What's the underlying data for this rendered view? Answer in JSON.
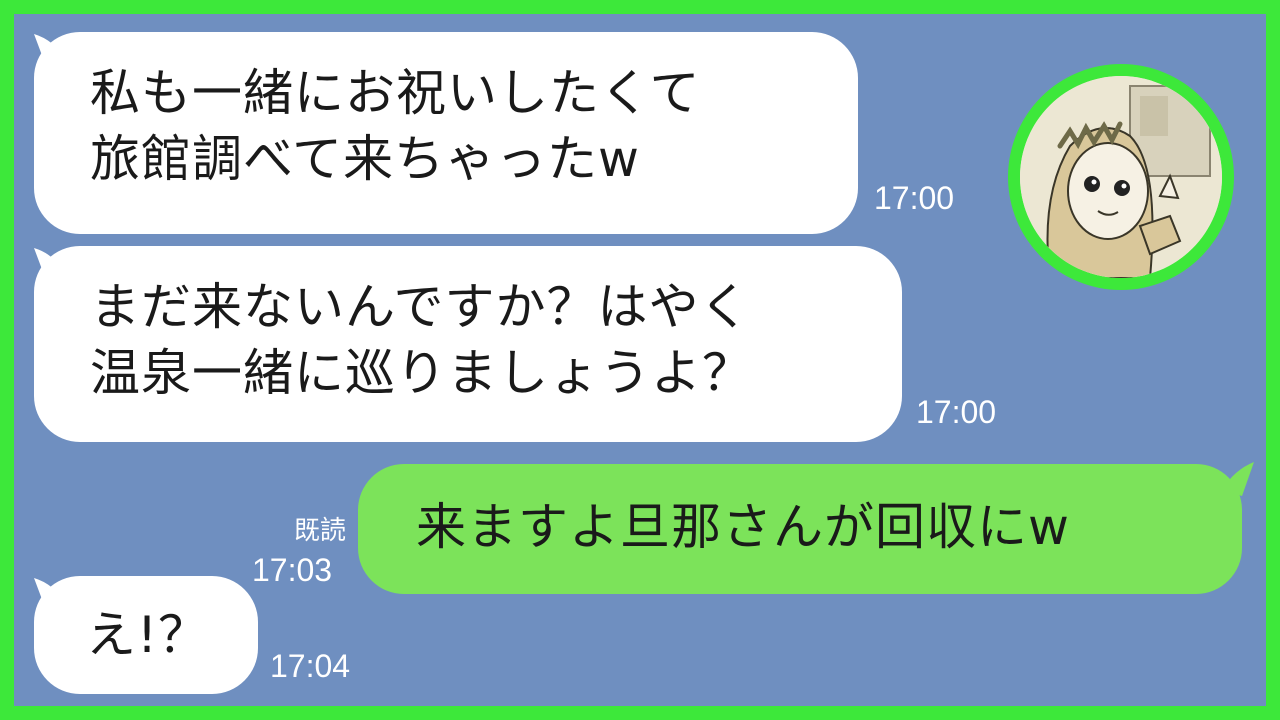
{
  "messages": [
    {
      "lines": [
        "私も一緒にお祝いしたくて",
        "旅館調べて来ちゃったw"
      ],
      "time": "17:00"
    },
    {
      "lines": [
        "まだ来ないんですか？はやく",
        "温泉一緒に巡りましょうよ？"
      ],
      "time": "17:00"
    },
    {
      "lines": [
        "来ますよ旦那さんが回収にw"
      ],
      "time": "17:03",
      "read": "既読"
    },
    {
      "lines": [
        "え!？"
      ],
      "time": "17:04"
    }
  ],
  "colors": {
    "background": "#6f8fc0",
    "border": "#3de83a",
    "incoming": "#ffffff",
    "outgoing": "#7ce35a"
  },
  "avatar_icon": "contact-avatar-illustration"
}
